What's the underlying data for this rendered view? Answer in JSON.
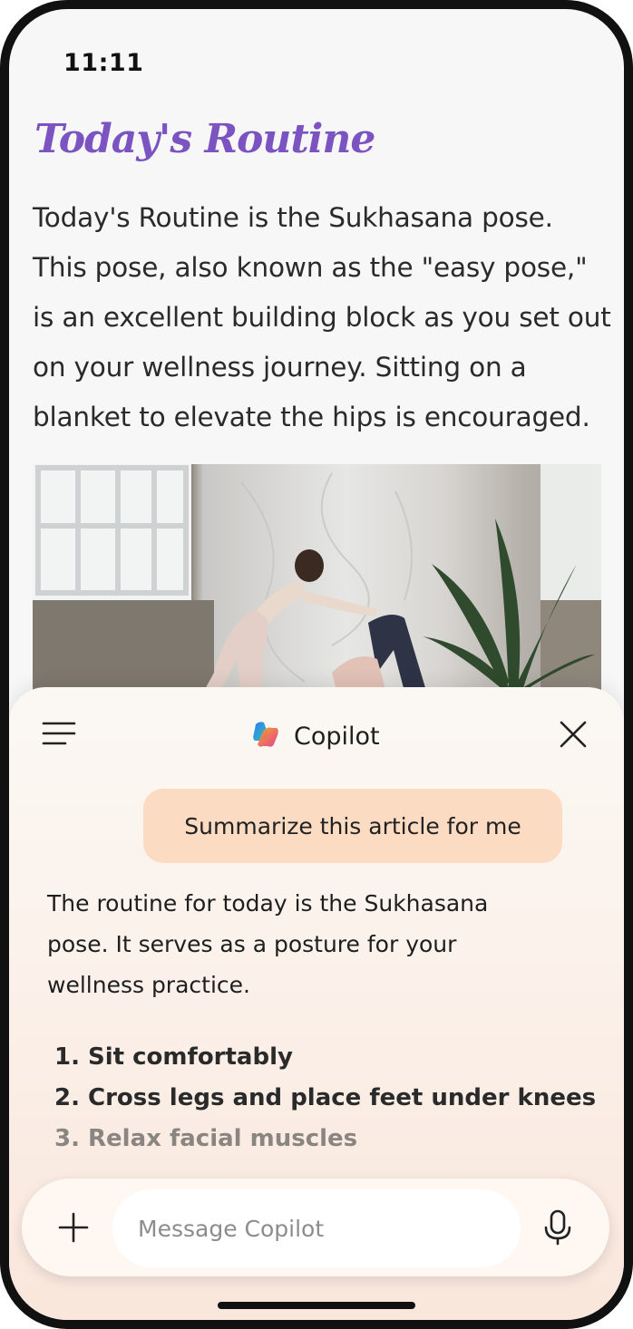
{
  "status_bar": {
    "time": "11:11"
  },
  "article": {
    "title": "Today's Routine",
    "body": "Today's Routine is the Sukhasana pose. This pose, also known as the \"easy pose,\" is an excellent building block as you set out on your wellness journey. Sitting on a blanket to elevate the hips is encouraged."
  },
  "copilot": {
    "title": "Copilot",
    "menu_icon": "hamburger-menu-icon",
    "close_icon": "close-icon",
    "user_message": "Summarize this article for me",
    "reply_text": "The routine for today is the Sukhasana pose. It serves as a posture for your wellness practice.",
    "steps": [
      "1. Sit comfortably",
      "2. Cross legs and place feet under knees",
      "3. Relax facial muscles"
    ],
    "composer": {
      "placeholder": "Message Copilot",
      "value": "",
      "plus_icon": "plus-icon",
      "mic_icon": "microphone-icon"
    }
  },
  "colors": {
    "title_accent": "#7b54c2",
    "user_bubble": "#fbdcc3",
    "sheet_bottom": "#f9e6db"
  }
}
